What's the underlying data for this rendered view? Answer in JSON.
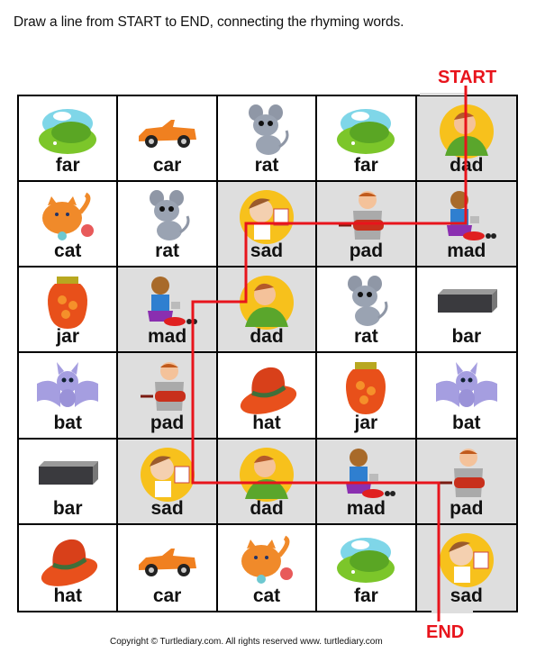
{
  "instruction": "Draw a line from START to END, connecting the rhyming words.",
  "start_label": "START",
  "end_label": "END",
  "copyright": "Copyright © Turtlediary.com. All rights reserved   www. turtlediary.com",
  "colors": {
    "path": "#e8141c",
    "shaded": "#dedede",
    "grid": "#000000"
  },
  "grid": [
    [
      {
        "word": "far",
        "icon": "hill-icon",
        "shaded": false
      },
      {
        "word": "car",
        "icon": "car-icon",
        "shaded": false
      },
      {
        "word": "rat",
        "icon": "rat-icon",
        "shaded": false
      },
      {
        "word": "far",
        "icon": "hill-icon",
        "shaded": false
      },
      {
        "word": "dad",
        "icon": "dad-icon",
        "shaded": true
      }
    ],
    [
      {
        "word": "cat",
        "icon": "cat-icon",
        "shaded": false
      },
      {
        "word": "rat",
        "icon": "rat-icon",
        "shaded": false
      },
      {
        "word": "sad",
        "icon": "sad-boy-icon",
        "shaded": true
      },
      {
        "word": "pad",
        "icon": "pad-boy-icon",
        "shaded": true
      },
      {
        "word": "mad",
        "icon": "mad-kid-icon",
        "shaded": true
      }
    ],
    [
      {
        "word": "jar",
        "icon": "jar-icon",
        "shaded": false
      },
      {
        "word": "mad",
        "icon": "mad-kid-icon",
        "shaded": true
      },
      {
        "word": "dad",
        "icon": "dad-icon",
        "shaded": true
      },
      {
        "word": "rat",
        "icon": "rat-icon",
        "shaded": false
      },
      {
        "word": "bar",
        "icon": "bar-icon",
        "shaded": false
      }
    ],
    [
      {
        "word": "bat",
        "icon": "bat-icon",
        "shaded": false
      },
      {
        "word": "pad",
        "icon": "pad-boy-icon",
        "shaded": true
      },
      {
        "word": "hat",
        "icon": "hat-icon",
        "shaded": false
      },
      {
        "word": "jar",
        "icon": "jar-icon",
        "shaded": false
      },
      {
        "word": "bat",
        "icon": "bat-icon",
        "shaded": false
      }
    ],
    [
      {
        "word": "bar",
        "icon": "bar-icon",
        "shaded": false
      },
      {
        "word": "sad",
        "icon": "sad-boy-icon",
        "shaded": true
      },
      {
        "word": "dad",
        "icon": "dad-icon",
        "shaded": true
      },
      {
        "word": "mad",
        "icon": "mad-kid-icon",
        "shaded": true
      },
      {
        "word": "pad",
        "icon": "pad-boy-icon",
        "shaded": true
      }
    ],
    [
      {
        "word": "hat",
        "icon": "hat-icon",
        "shaded": false
      },
      {
        "word": "car",
        "icon": "car-icon",
        "shaded": false
      },
      {
        "word": "cat",
        "icon": "cat-icon",
        "shaded": false
      },
      {
        "word": "far",
        "icon": "hill-icon",
        "shaded": false
      },
      {
        "word": "sad",
        "icon": "sad-boy-icon",
        "shaded": true
      }
    ]
  ],
  "solution_path_cells": [
    [
      0,
      4
    ],
    [
      1,
      4
    ],
    [
      1,
      3
    ],
    [
      1,
      2
    ],
    [
      2,
      2
    ],
    [
      2,
      1
    ],
    [
      3,
      1
    ],
    [
      4,
      1
    ],
    [
      4,
      2
    ],
    [
      4,
      3
    ],
    [
      4,
      4
    ],
    [
      5,
      4
    ]
  ]
}
